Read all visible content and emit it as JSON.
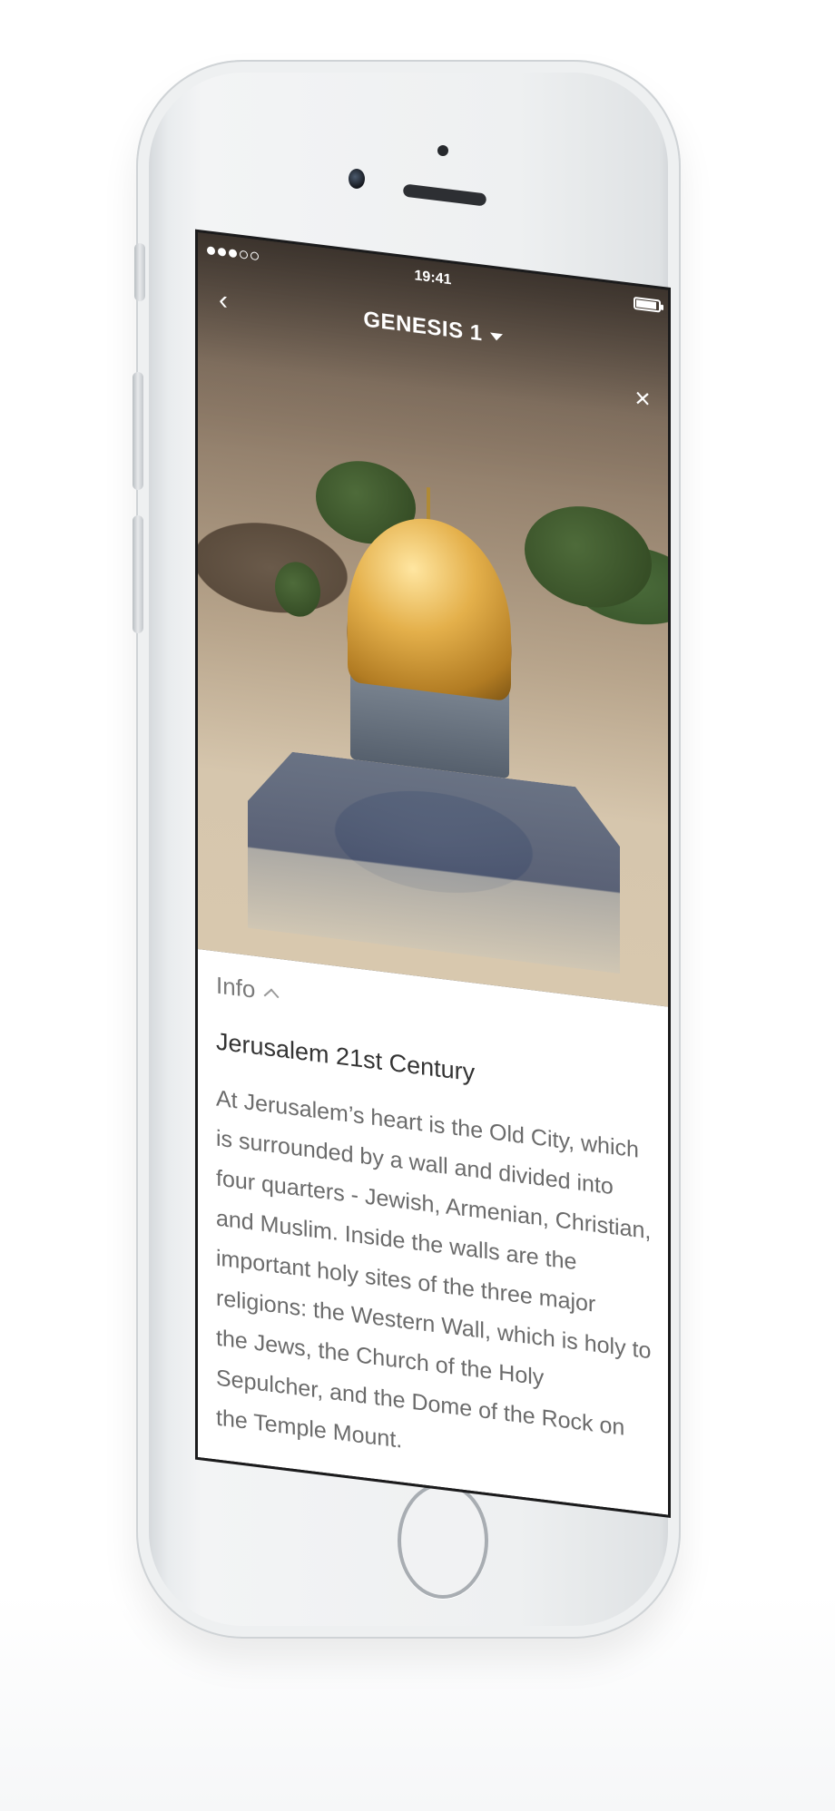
{
  "status_bar": {
    "time": "19:41",
    "signal_bars_filled": 3,
    "signal_bars_total": 5,
    "battery_level_percent": 90
  },
  "nav": {
    "back_icon": "chevron-left-icon",
    "book_title": "GENESIS 1",
    "close_icon": "close-icon"
  },
  "media": {
    "image_subject": "Dome of the Rock, Jerusalem"
  },
  "info": {
    "toggle_label": "Info",
    "title": "Jerusalem 21st Century",
    "body": "At Jerusalem’s heart is the Old City, which is surrounded by a wall and divided into four quarters - Jewish, Armenian, Christian, and Muslim. Inside the walls are the important holy sites of the three major religions: the Western Wall, which is holy to the Jews, the Church of the Holy Sepulcher, and the Dome of the Rock on the Temple Mount."
  },
  "colors": {
    "phone_body": "#eef0f1",
    "screen_bg": "#ffffff",
    "body_text": "#6b6b6b",
    "title_text": "#333333"
  }
}
